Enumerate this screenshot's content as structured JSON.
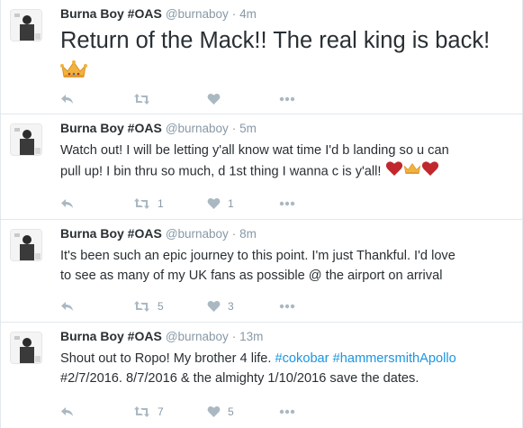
{
  "colors": {
    "name": "#292f33",
    "meta": "#8899a6",
    "hashtag": "#1b95e0",
    "divider": "#e1e8ed",
    "heart_emoji": "#c0282d",
    "crown_emoji": "#f2b33d"
  },
  "tweets": [
    {
      "name": "Burna Boy #OAS",
      "handle": "@burnaboy",
      "dot": "·",
      "time": "4m",
      "text": "Return of the Mack!! The real king is back!",
      "emoji": [
        "crown"
      ],
      "retweets": "",
      "likes": ""
    },
    {
      "name": "Burna Boy #OAS",
      "handle": "@burnaboy",
      "dot": "·",
      "time": "5m",
      "text_line1": "Watch out! I will be letting y'all know wat time I'd b landing so u can",
      "text_line2": "pull up! I bin thru so much, d 1st thing I wanna c is y'all!",
      "emoji": [
        "red-heart",
        "crown",
        "red-heart"
      ],
      "retweets": "1",
      "likes": "1"
    },
    {
      "name": "Burna Boy #OAS",
      "handle": "@burnaboy",
      "dot": "·",
      "time": "8m",
      "text_line1": "It's been such an epic  journey to this point. I'm just Thankful. I'd love",
      "text_line2": "to see as many of my UK fans as possible @ the airport on arrival",
      "retweets": "5",
      "likes": "3"
    },
    {
      "name": "Burna Boy #OAS",
      "handle": "@burnaboy",
      "dot": "·",
      "time": "13m",
      "text_pre": "Shout out to Ropo! My brother 4 life. ",
      "hashtag1": "#cokobar",
      "hashtag2": "#hammersmithApollo",
      "text_line2": "#2/7/2016. 8/7/2016 & the almighty 1/10/2016 save the dates.",
      "retweets": "7",
      "likes": "5"
    }
  ],
  "icons": [
    "reply-icon",
    "retweet-icon",
    "like-icon",
    "more-icon"
  ]
}
